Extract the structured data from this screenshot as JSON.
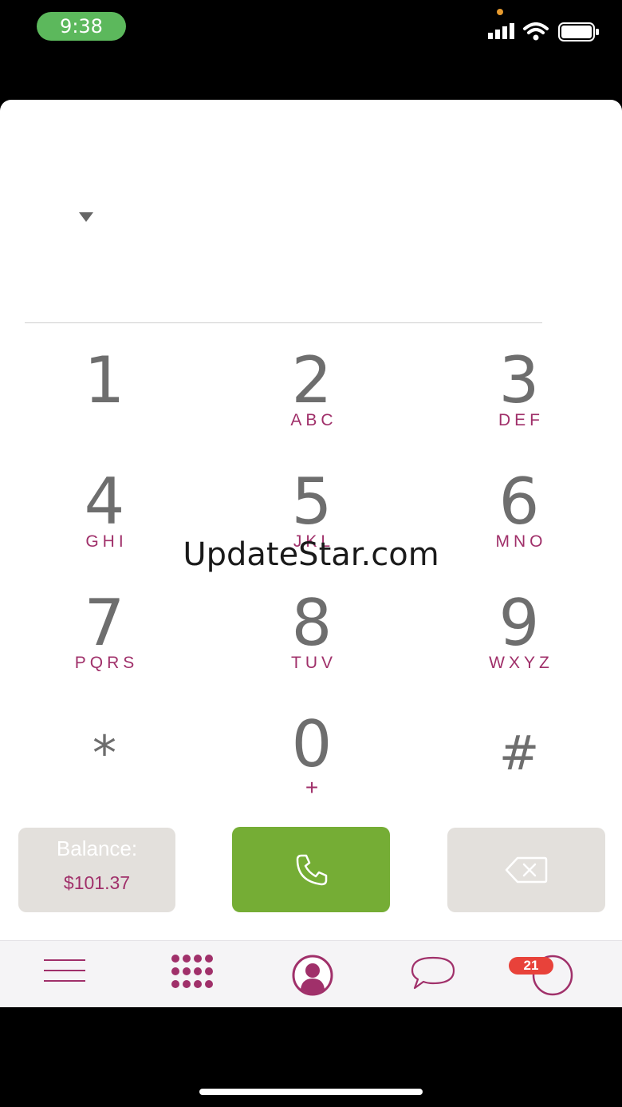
{
  "status_bar": {
    "time": "9:38",
    "icons": [
      "cellular-signal-icon",
      "wifi-icon",
      "battery-icon"
    ],
    "time_pill_color": "#5cb85c"
  },
  "dialer": {
    "number_value": "",
    "keys": [
      {
        "digit": "1",
        "letters": ""
      },
      {
        "digit": "2",
        "letters": "ABC"
      },
      {
        "digit": "3",
        "letters": "DEF"
      },
      {
        "digit": "4",
        "letters": "GHI"
      },
      {
        "digit": "5",
        "letters": "JKL"
      },
      {
        "digit": "6",
        "letters": "MNO"
      },
      {
        "digit": "7",
        "letters": "PQRS"
      },
      {
        "digit": "8",
        "letters": "TUV"
      },
      {
        "digit": "9",
        "letters": "WXYZ"
      },
      {
        "digit": "*",
        "letters": ""
      },
      {
        "digit": "0",
        "letters": "+"
      },
      {
        "digit": "#",
        "letters": ""
      }
    ]
  },
  "watermark": "UpdateStar.com",
  "balance": {
    "label": "Balance:",
    "value": "$101.37"
  },
  "actions": {
    "call_icon": "phone-icon",
    "backspace_icon": "backspace-icon",
    "call_color": "#75ad35"
  },
  "tabbar": {
    "items": [
      "menu-icon",
      "keypad-icon",
      "contacts-icon",
      "messages-icon",
      "history-icon"
    ],
    "badge_count": "21",
    "accent_color": "#a0306a"
  }
}
